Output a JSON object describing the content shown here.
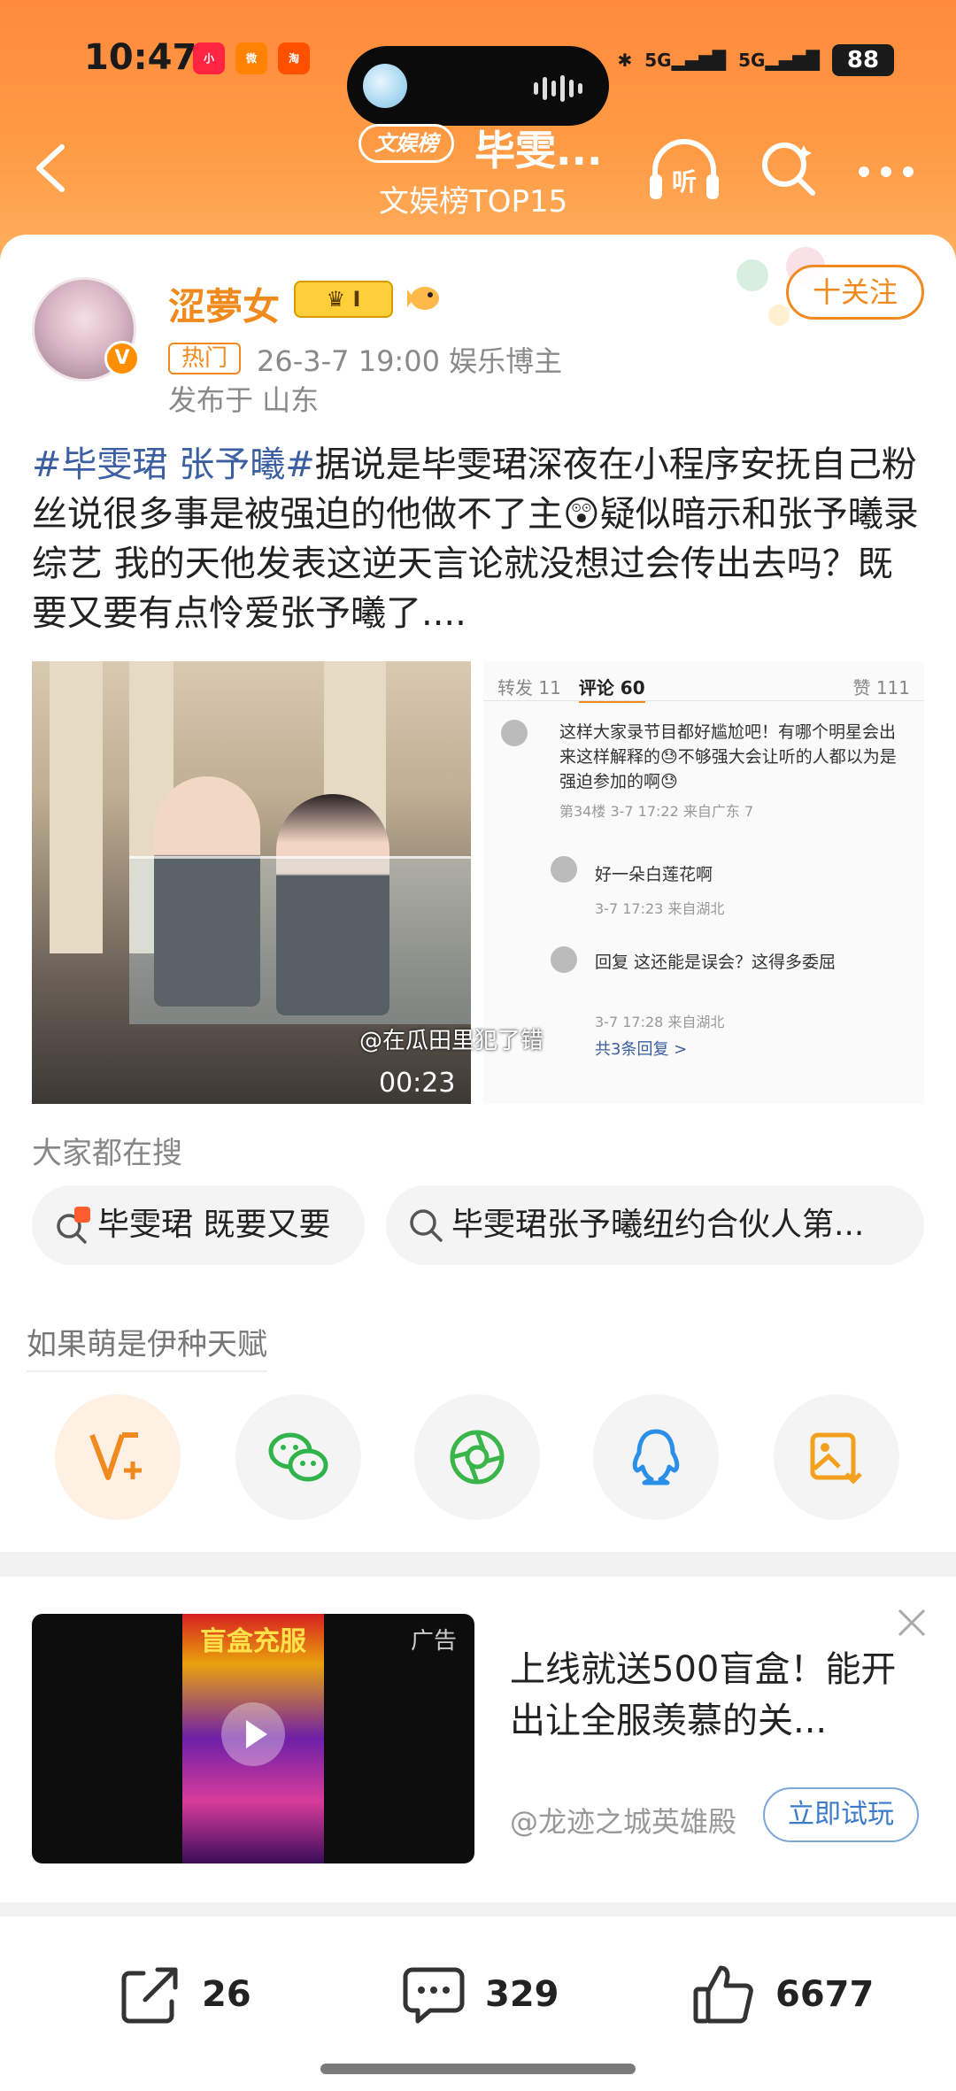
{
  "status_bar": {
    "time": "10:47",
    "apps": [
      "小红书",
      "微博",
      "淘"
    ],
    "signal1": "5G",
    "signal2": "5G",
    "battery": "88"
  },
  "nav": {
    "badge": "文娱榜",
    "title": "毕雯...",
    "subtitle": "文娱榜TOP15",
    "icons": [
      "back-icon",
      "listen-icon",
      "search-icon",
      "more-icon"
    ],
    "listen_label": "听"
  },
  "post": {
    "author": "涩夢女",
    "member_badge": "I",
    "follow_label": "十关注",
    "hot_tag": "热门",
    "meta": "26-3-7 19:00  娱乐博主",
    "location": "发布于 山东",
    "hashtag": "#毕雯珺 张予曦#",
    "body": "据说是毕雯珺深夜在小程序安抚自己粉丝说很多事是被强迫的他做不了主😲疑似暗示和张予曦录综艺 我的天他发表这逆天言论就没想过会传出去吗？既要又要有点怜爱张予曦了...."
  },
  "video": {
    "watermark": "@在瓜田里犯了错",
    "duration": "00:23"
  },
  "screenshot": {
    "tab_repost": "转发 11",
    "tab_comments": "评论 60",
    "likes": "赞 111",
    "comment1": "这样大家录节目都好尴尬吧！有哪个明星会出来这样解释的😓不够强大会让听的人都以为是强迫参加的啊😓",
    "comment1_meta": "第34楼 3-7 17:22 来自广东    7",
    "comment2": "好一朵白莲花啊",
    "comment2_meta": "3-7 17:23 来自湖北",
    "comment3": "回复  这还能是误会？这得多委屈",
    "comment3_meta": "3-7 17:28 来自湖北",
    "comment3_replies": "共3条回复 >"
  },
  "search": {
    "section_title": "大家都在搜",
    "chips": [
      "毕雯珺 既要又要",
      "毕雯珺张予曦纽约合伙人第..."
    ]
  },
  "share": {
    "hint": "如果萌是伊种天赋",
    "icons": [
      "repost-v-icon",
      "wechat-icon",
      "moments-icon",
      "qq-icon",
      "save-image-icon"
    ]
  },
  "ad": {
    "label": "广告",
    "poster_title": "盲盒充服",
    "title": "上线就送500盲盒！能开出让全服羡慕的关...",
    "source": "@龙迹之城英雄殿",
    "cta": "立即试玩"
  },
  "actions": {
    "reposts": "26",
    "comments": "329",
    "likes": "6677"
  },
  "colors": {
    "header_orange": "#ff9a44",
    "accent_orange": "#f08a1e",
    "link_blue": "#3b5fa0"
  }
}
